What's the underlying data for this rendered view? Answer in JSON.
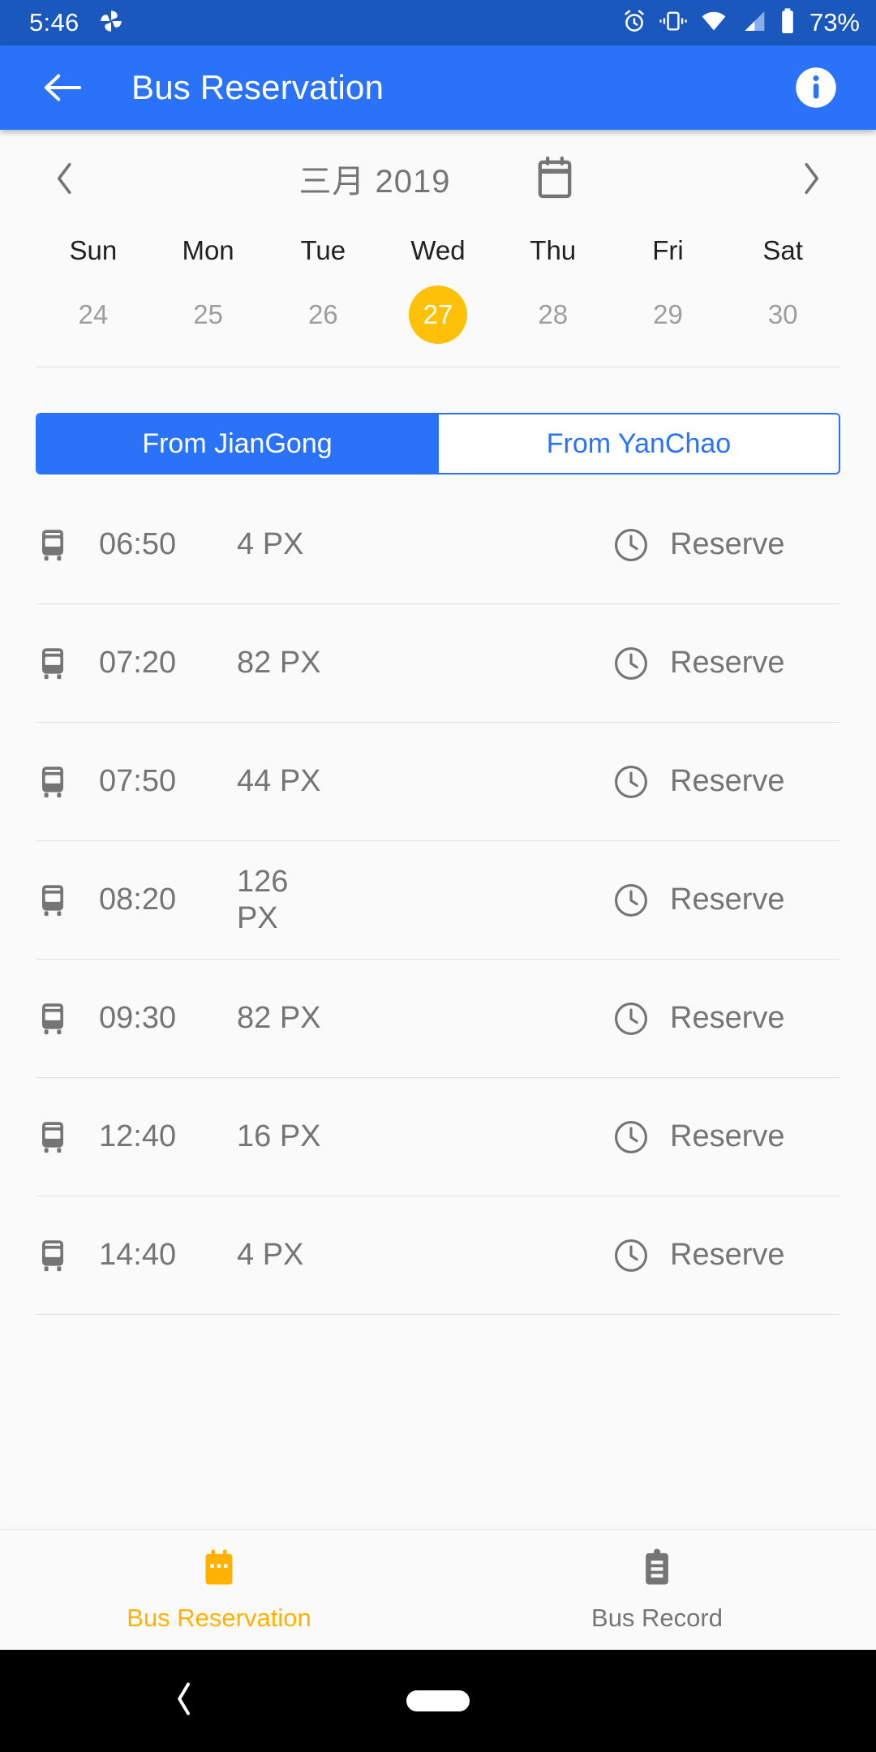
{
  "statusbar": {
    "time": "5:46",
    "battery_text": "73%",
    "icons": [
      "photos-pinwheel-icon",
      "alarm-icon",
      "vibrate-icon",
      "wifi-icon",
      "signal-icon",
      "battery-icon"
    ]
  },
  "appbar": {
    "title": "Bus Reservation",
    "back_icon": "arrow-left-icon",
    "info_icon": "info-icon",
    "bg_color": "#2a72f8"
  },
  "calendar": {
    "month_year": "三月 2019",
    "prev_label": "‹",
    "next_label": "›",
    "picker_icon": "calendar-icon",
    "day_names": [
      "Sun",
      "Mon",
      "Tue",
      "Wed",
      "Thu",
      "Fri",
      "Sat"
    ],
    "dates": [
      "24",
      "25",
      "26",
      "27",
      "28",
      "29",
      "30"
    ],
    "selected_date": "27",
    "selected_color": "#ffc107"
  },
  "segmented": {
    "options": [
      {
        "label": "From JianGong",
        "active": true
      },
      {
        "label": "From YanChao",
        "active": false
      }
    ]
  },
  "list": {
    "bus_icon": "bus-icon",
    "clock_icon": "clock-icon",
    "action_label": "Reserve",
    "rows": [
      {
        "time": "06:50",
        "seats": "4 PX",
        "action": "Reserve"
      },
      {
        "time": "07:20",
        "seats": "82 PX",
        "action": "Reserve"
      },
      {
        "time": "07:50",
        "seats": "44 PX",
        "action": "Reserve"
      },
      {
        "time": "08:20",
        "seats": "126 PX",
        "action": "Reserve"
      },
      {
        "time": "09:30",
        "seats": "82 PX",
        "action": "Reserve"
      },
      {
        "time": "12:40",
        "seats": "16 PX",
        "action": "Reserve"
      },
      {
        "time": "14:40",
        "seats": "4 PX",
        "action": "Reserve"
      }
    ]
  },
  "bottomnav": {
    "items": [
      {
        "label": "Bus Reservation",
        "icon": "calendar-icon",
        "active": true,
        "color": "#ffb300"
      },
      {
        "label": "Bus Record",
        "icon": "clipboard-icon",
        "active": false,
        "color": "#757575"
      }
    ]
  },
  "navbar": {
    "back_icon": "nav-back-icon",
    "home_icon": "nav-home-pill"
  }
}
